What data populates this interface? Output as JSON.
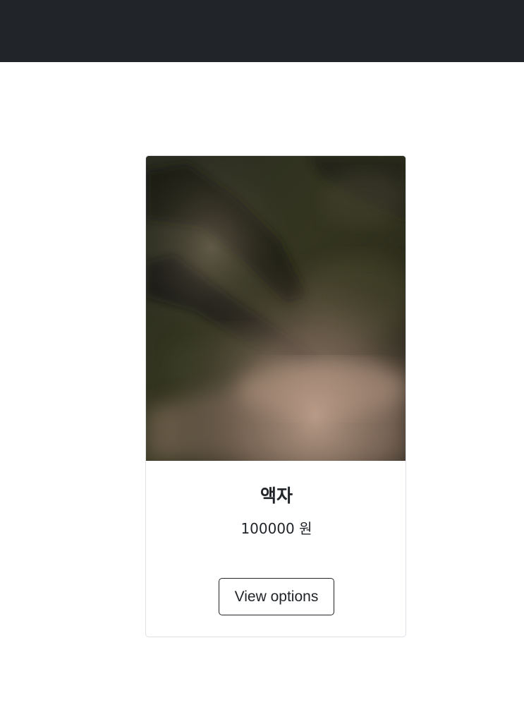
{
  "header": {
    "background": "#212529"
  },
  "product": {
    "image": {
      "description_icon": "aerial-landscape-image",
      "tones": [
        "#1f2119",
        "#3a3d28",
        "#6b5f50",
        "#c1a08c"
      ]
    },
    "name": "액자",
    "price": "100000 원",
    "button_label": "View options"
  }
}
